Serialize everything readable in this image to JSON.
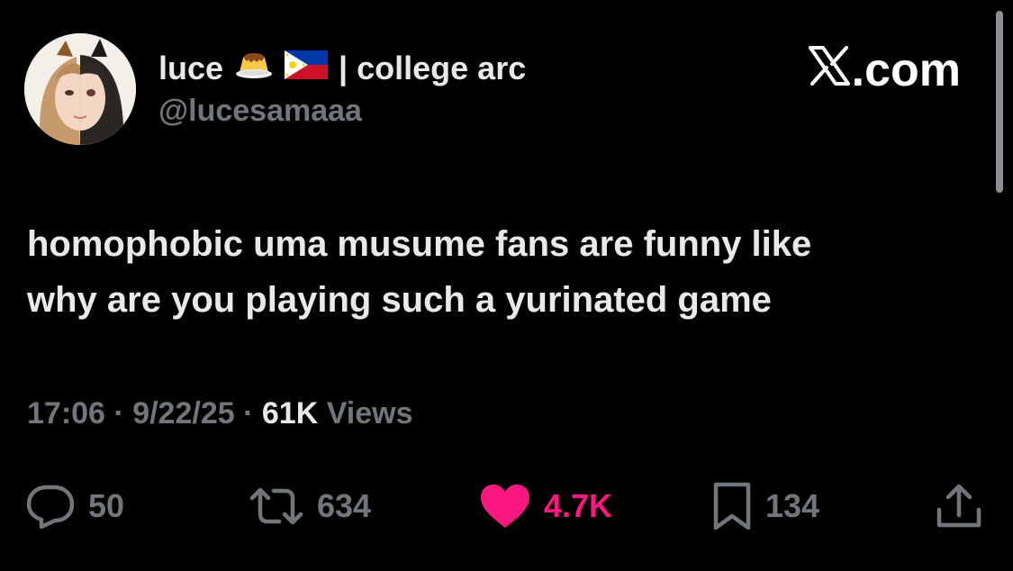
{
  "author": {
    "display_name": "luce",
    "name_emojis": [
      "flan-emoji",
      "philippines-flag-emoji"
    ],
    "name_suffix": "| college arc",
    "handle": "@lucesamaaa"
  },
  "brand": {
    "logo_icon": "x-logo-icon",
    "text": ".com"
  },
  "tweet": {
    "lines": [
      "homophobic uma musume fans are funny like",
      "why are you playing such a yurinated game"
    ]
  },
  "meta": {
    "time": "17:06",
    "separator": "·",
    "date": "9/22/25",
    "views_count": "61K",
    "views_label": "Views"
  },
  "actions": {
    "replies": "50",
    "reposts": "634",
    "likes": "4.7K",
    "bookmarks": "134"
  },
  "colors": {
    "background": "#000000",
    "primary_text": "#e7e9ea",
    "secondary_text": "#71767b",
    "like_active": "#f91880"
  }
}
